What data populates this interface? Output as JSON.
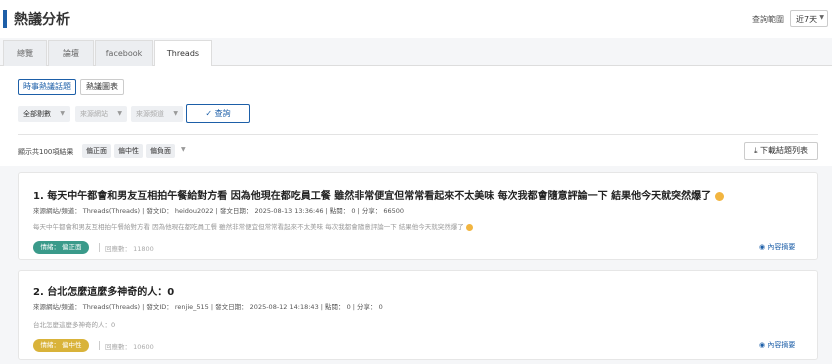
{
  "header": {
    "title": "熱議分析",
    "range_label": "查詢範圍",
    "range_value": "近7天"
  },
  "tabs": [
    {
      "label": "總覽",
      "active": false
    },
    {
      "label": "論壇",
      "active": false
    },
    {
      "label": "facebook",
      "active": false
    },
    {
      "label": "Threads",
      "active": true
    }
  ],
  "subtabs": [
    {
      "label": "時事熱議話題",
      "active": true
    },
    {
      "label": "熱議圖表",
      "active": false
    }
  ],
  "filters": {
    "all_status": "全部剔數",
    "source_site": "來源網站",
    "source_channel": "來源頻道",
    "query_label": "查詢"
  },
  "results": {
    "count_text": "顯示共100項結果",
    "chips": [
      "偏正面",
      "偏中性",
      "偏負面"
    ],
    "download_label": "下載結題列表"
  },
  "cards": [
    {
      "title": "1. 每天中午都會和男友互相拍午餐給對方看 因為他現在都吃員工餐 雖然非常便宜但常常看起來不太美味 每次我都會隨意評論一下 結果他今天就突然爆了",
      "meta": "來源網站/頻道： Threads(Threads) | 發文ID： heidou2022 | 發文日期： 2025-08-13 13:36:46 | 點閱： 0 | 分享： 66500",
      "body": "每天中午都會和男友互相拍午餐給對方看 因為他現在都吃員工餐 雖然非常便宜但常常看起來不太美味 每次我都會隨意評論一下 結果他今天就突然爆了",
      "sentiment": "情緒： 偏正面",
      "sentiment_color": "#3a9a8a",
      "replies": "回應數： 11800",
      "summary": "內容摘要"
    },
    {
      "title": "2. 台北怎麼這麼多神奇的人：0",
      "meta": "來源網站/頻道： Threads(Threads) | 發文ID： renjie_515 | 發文日期： 2025-08-12 14:18:43 | 點閱： 0 | 分享： 0",
      "body": "台北怎麼這麼多神奇的人：0",
      "sentiment": "情緒： 偏中性",
      "sentiment_color": "#d9b33a",
      "replies": "回應數： 10600",
      "summary": "內容摘要"
    }
  ]
}
